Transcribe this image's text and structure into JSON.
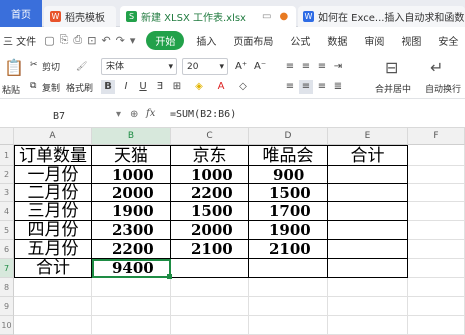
{
  "tabs": [
    {
      "label": "首页"
    },
    {
      "label": "稻壳模板"
    },
    {
      "label": "新建 XLSX 工作表.xlsx"
    },
    {
      "label": "如何在 Exce...插入自动求和函数"
    }
  ],
  "menu": {
    "file": "三 文件",
    "start": "开始",
    "items": [
      "插入",
      "页面布局",
      "公式",
      "数据",
      "审阅",
      "视图",
      "安全"
    ]
  },
  "ribbon": {
    "paste": "粘贴",
    "cut": "剪切",
    "copy": "复制",
    "format_painter": "格式刷",
    "font_name": "宋体",
    "font_size": "20",
    "bold": "B",
    "italic": "I",
    "underline": "U",
    "grow": "A⁺",
    "shrink": "A⁻",
    "merge": "合并居中",
    "wrap": "自动换行"
  },
  "formula_bar": {
    "cell_ref": "B7",
    "fx": "fx",
    "formula": "=SUM(B2:B6)"
  },
  "columns": [
    "A",
    "B",
    "C",
    "D",
    "E",
    "F"
  ],
  "rows": [
    "1",
    "2",
    "3",
    "4",
    "5",
    "6",
    "7",
    "8",
    "9",
    "10"
  ],
  "sheet": {
    "headers": [
      "订单数量",
      "天猫",
      "京东",
      "唯品会",
      "合计"
    ],
    "data": [
      [
        "一月份",
        "1000",
        "1000",
        "900",
        ""
      ],
      [
        "二月份",
        "2000",
        "2200",
        "1500",
        ""
      ],
      [
        "三月份",
        "1900",
        "1500",
        "1700",
        ""
      ],
      [
        "四月份",
        "2300",
        "2000",
        "1900",
        ""
      ],
      [
        "五月份",
        "2200",
        "2100",
        "2100",
        ""
      ],
      [
        "合计",
        "9400",
        "",
        "",
        ""
      ]
    ]
  },
  "colors": {
    "accent": "#1e8c44",
    "start_button": "#22a14a",
    "home_tab": "#3a6fdb"
  }
}
